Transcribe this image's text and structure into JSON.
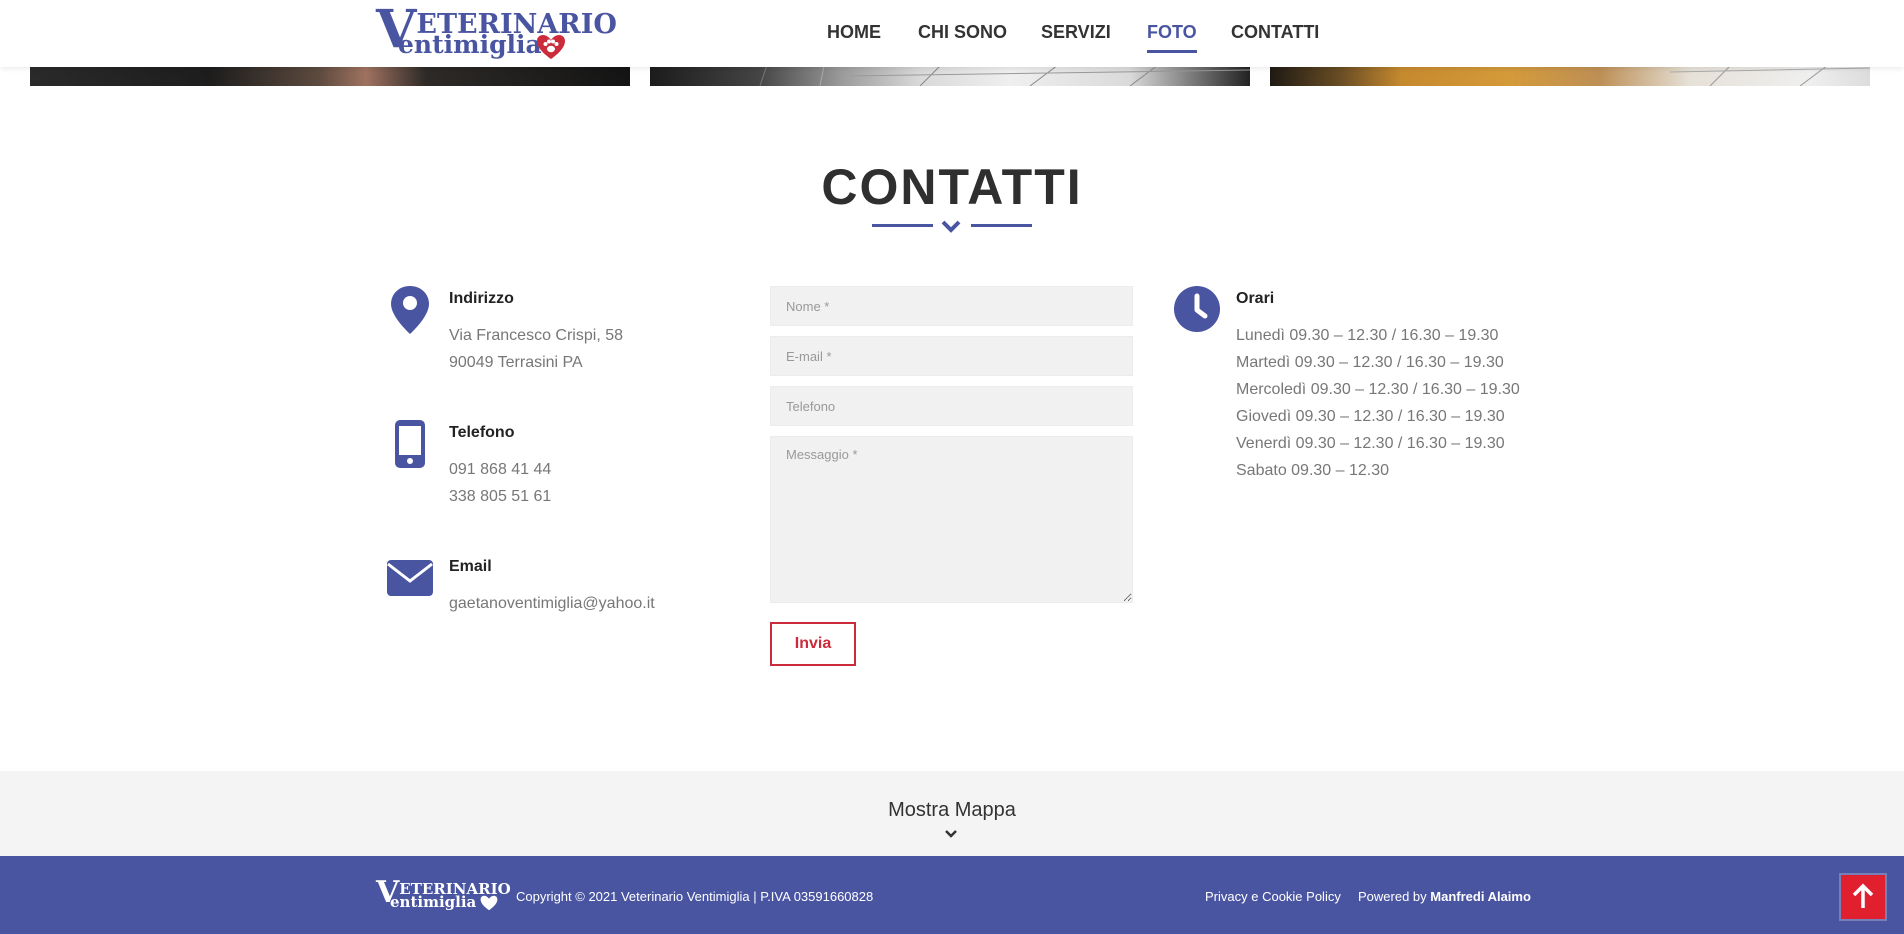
{
  "header": {
    "logo_line1": "ETERINARIO",
    "logo_initial": "V",
    "logo_line2": "entimiglia",
    "nav": [
      {
        "label": "HOME"
      },
      {
        "label": "CHI SONO"
      },
      {
        "label": "SERVIZI"
      },
      {
        "label": "FOTO",
        "active": true
      },
      {
        "label": "CONTATTI"
      }
    ]
  },
  "contact": {
    "title": "CONTATTI",
    "address": {
      "title": "Indirizzo",
      "line1": "Via Francesco Crispi, 58",
      "line2": "90049 Terrasini PA"
    },
    "phone": {
      "title": "Telefono",
      "line1": "091 868 41 44",
      "line2": "338 805 51 61"
    },
    "email": {
      "title": "Email",
      "line1": "gaetanoventimiglia@yahoo.it"
    },
    "hours": {
      "title": "Orari",
      "lines": [
        "Lunedì 09.30 – 12.30 / 16.30 – 19.30",
        "Martedì 09.30 – 12.30 / 16.30 – 19.30",
        "Mercoledì 09.30 – 12.30 / 16.30 – 19.30",
        "Giovedì 09.30 – 12.30 / 16.30 – 19.30",
        "Venerdì 09.30 – 12.30 / 16.30 – 19.30",
        "Sabato 09.30 – 12.30"
      ]
    },
    "form": {
      "name_placeholder": "Nome *",
      "email_placeholder": "E-mail *",
      "phone_placeholder": "Telefono",
      "message_placeholder": "Messaggio *",
      "submit_label": "Invia"
    }
  },
  "map": {
    "label": "Mostra Mappa"
  },
  "footer": {
    "logo_initial": "V",
    "logo_line1": "ETERINARIO",
    "logo_line2": "entimiglia",
    "copyright": "Copyright © 2021 Veterinario Ventimiglia | P.IVA 03591660828",
    "privacy_link": "Privacy e Cookie Policy",
    "powered_prefix": "Powered by",
    "powered_name": "Manfredi Alaimo"
  },
  "colors": {
    "accent": "#4a55a2",
    "danger": "#cc2b3b",
    "to_top": "#e0202e"
  },
  "icons": {
    "address": "map-pin-icon",
    "phone": "smartphone-icon",
    "email": "envelope-icon",
    "hours": "clock-icon",
    "to_top": "arrow-up-icon",
    "map": "chevron-down-icon"
  }
}
